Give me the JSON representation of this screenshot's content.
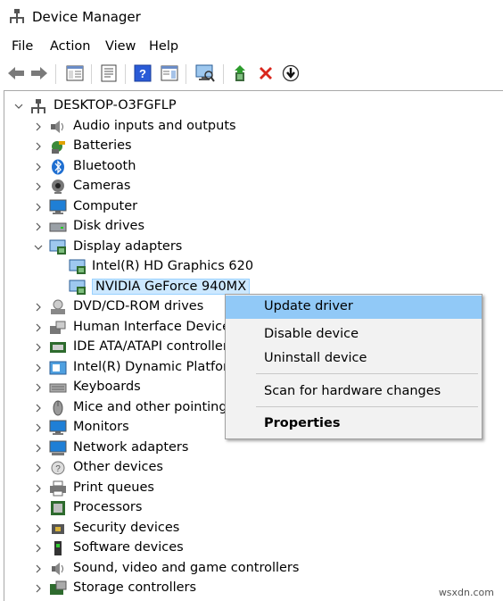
{
  "window": {
    "title": "Device Manager"
  },
  "menu": {
    "file": "File",
    "action": "Action",
    "view": "View",
    "help": "Help"
  },
  "toolbar": {
    "icons": [
      "back-arrow-icon",
      "forward-arrow-icon",
      "show-hide-console-tree-icon",
      "properties-icon",
      "help-icon",
      "action-pane-icon",
      "monitor-scan-icon",
      "update-driver-icon",
      "uninstall-x-icon",
      "download-icon"
    ]
  },
  "tree": {
    "root": "DESKTOP-O3FGFLP",
    "categories": [
      {
        "label": "Audio inputs and outputs",
        "icon": "speaker-icon"
      },
      {
        "label": "Batteries",
        "icon": "battery-icon"
      },
      {
        "label": "Bluetooth",
        "icon": "bluetooth-icon"
      },
      {
        "label": "Cameras",
        "icon": "camera-icon"
      },
      {
        "label": "Computer",
        "icon": "computer-icon"
      },
      {
        "label": "Disk drives",
        "icon": "disk-drive-icon"
      },
      {
        "label": "Display adapters",
        "icon": "display-adapter-icon",
        "expanded": true,
        "children": [
          {
            "label": "Intel(R) HD Graphics 620",
            "icon": "display-adapter-icon"
          },
          {
            "label": "NVIDIA GeForce 940MX",
            "icon": "display-adapter-icon",
            "selected": true
          }
        ]
      },
      {
        "label": "DVD/CD-ROM drives",
        "icon": "dvd-drive-icon"
      },
      {
        "label": "Human Interface Devices",
        "icon": "hid-icon"
      },
      {
        "label": "IDE ATA/ATAPI controllers",
        "icon": "ide-controller-icon"
      },
      {
        "label": "Intel(R) Dynamic Platform a",
        "icon": "platform-icon"
      },
      {
        "label": "Keyboards",
        "icon": "keyboard-icon"
      },
      {
        "label": "Mice and other pointing d",
        "icon": "mouse-icon"
      },
      {
        "label": "Monitors",
        "icon": "monitor-icon"
      },
      {
        "label": "Network adapters",
        "icon": "network-adapter-icon"
      },
      {
        "label": "Other devices",
        "icon": "other-devices-icon"
      },
      {
        "label": "Print queues",
        "icon": "printer-icon"
      },
      {
        "label": "Processors",
        "icon": "processor-icon"
      },
      {
        "label": "Security devices",
        "icon": "security-device-icon"
      },
      {
        "label": "Software devices",
        "icon": "software-device-icon"
      },
      {
        "label": "Sound, video and game controllers",
        "icon": "sound-icon"
      },
      {
        "label": "Storage controllers",
        "icon": "storage-controller-icon"
      }
    ]
  },
  "context_menu": {
    "update_driver": "Update driver",
    "disable_device": "Disable device",
    "uninstall_device": "Uninstall device",
    "scan_hardware": "Scan for hardware changes",
    "properties": "Properties"
  },
  "watermark": "wsxdn.com",
  "colors": {
    "selection": "#cce8ff",
    "menu_highlight": "#91c9f7",
    "annotation_red": "#e0202a"
  }
}
